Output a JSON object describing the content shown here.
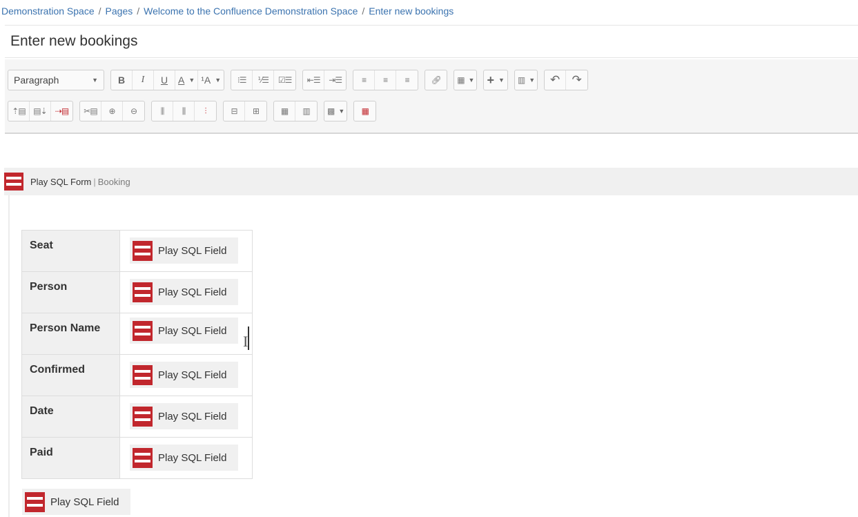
{
  "breadcrumb": {
    "items": [
      "Demonstration Space",
      "Pages",
      "Welcome to the Confluence Demonstration Space",
      "Enter new bookings"
    ],
    "separator": "/"
  },
  "page": {
    "title": "Enter new bookings"
  },
  "toolbar": {
    "paragraph_label": "Paragraph",
    "bold": "B",
    "italic": "I",
    "underline": "U",
    "text_color": "A",
    "style_more": "¹A",
    "icons_row1": [
      "bullet-list-icon",
      "numbered-list-icon",
      "task-list-icon",
      "outdent-icon",
      "indent-icon",
      "align-left-icon",
      "align-center-icon",
      "align-right-icon",
      "link-icon",
      "table-icon",
      "insert-more-icon",
      "page-layout-icon",
      "undo-icon",
      "redo-icon"
    ],
    "icons_row2": [
      "row-above-icon",
      "row-below-icon",
      "delete-row-icon",
      "cut-row-icon",
      "copy-row-icon",
      "paste-row-icon",
      "column-before-icon",
      "column-after-icon",
      "delete-column-icon",
      "merge-cells-icon",
      "split-cell-icon",
      "header-row-icon",
      "header-column-icon",
      "cell-color-icon",
      "delete-table-icon"
    ]
  },
  "macro": {
    "name": "Play SQL Form",
    "separator": "|",
    "param": "Booking",
    "brand_color": "#c1272d"
  },
  "form": {
    "rows": [
      {
        "label": "Seat",
        "field": "Play SQL Field"
      },
      {
        "label": "Person",
        "field": "Play SQL Field"
      },
      {
        "label": "Person Name",
        "field": "Play SQL Field"
      },
      {
        "label": "Confirmed",
        "field": "Play SQL Field"
      },
      {
        "label": "Date",
        "field": "Play SQL Field"
      },
      {
        "label": "Paid",
        "field": "Play SQL Field"
      }
    ],
    "extra_field": "Play SQL Field"
  }
}
